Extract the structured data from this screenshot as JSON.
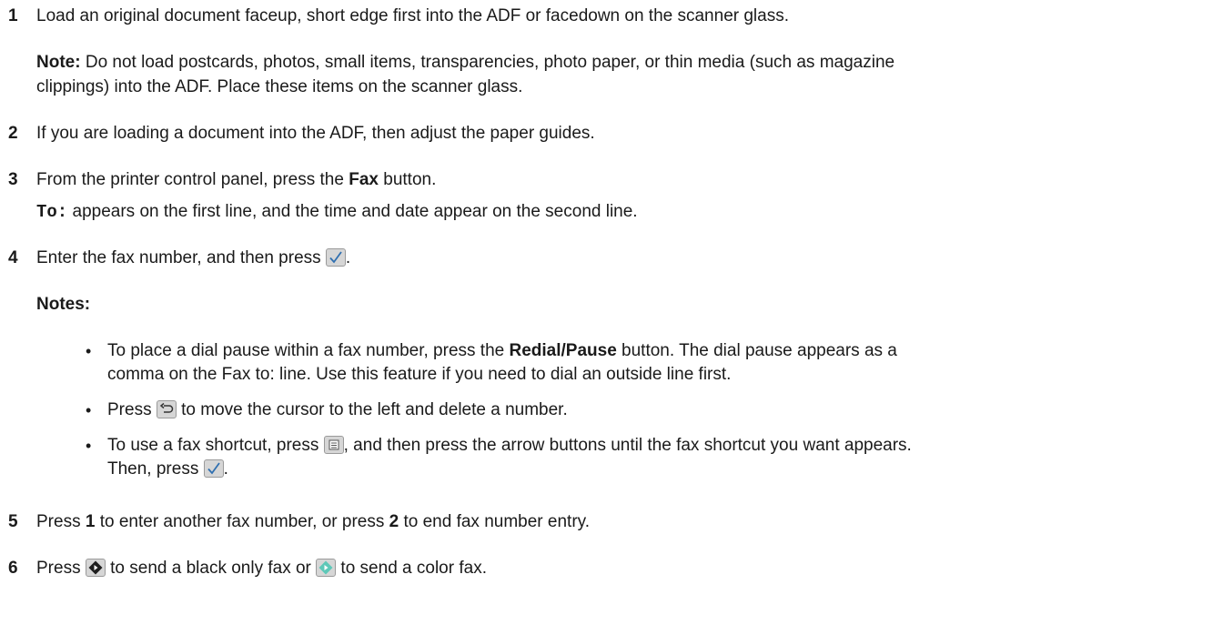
{
  "steps": [
    {
      "number": "1",
      "text": "Load an original document faceup, short edge first into the ADF or facedown on the scanner glass."
    },
    {
      "number": "2",
      "text": "If you are loading a document into the ADF, then adjust the paper guides."
    },
    {
      "number": "3",
      "text_before": "From the printer control panel, press the ",
      "bold": "Fax",
      "text_after": " button."
    },
    {
      "number": "4",
      "text_before": "Enter the fax number, and then press ",
      "text_after": "."
    },
    {
      "number": "5",
      "t1": "Press ",
      "b1": "1",
      "t2": " to enter another fax number, or press ",
      "b2": "2",
      "t3": " to end fax number entry."
    },
    {
      "number": "6",
      "t1": "Press ",
      "t2": " to send a black only fax or ",
      "t3": " to send a color fax."
    }
  ],
  "note": {
    "label": "Note:",
    "line1": " Do not load postcards, photos, small items, transparencies, photo paper, or thin media (such as magazine",
    "line2": "clippings) into the ADF. Place these items on the scanner glass."
  },
  "display_line": {
    "code": "To:",
    "text": " appears on the first line, and the time and date appear on the second line."
  },
  "notes_heading": "Notes:",
  "bullets": [
    {
      "t1": "To place a dial pause within a fax number, press the ",
      "b1": "Redial/Pause",
      "t2": " button. The dial pause appears as a",
      "line2": "comma on the Fax to: line. Use this feature if you need to dial an outside line first."
    },
    {
      "t1": "Press ",
      "t2": " to move the cursor to the left and delete a number."
    },
    {
      "t1": "To use a fax shortcut, press ",
      "t2": ", and then press the arrow buttons until the fax shortcut you want appears.",
      "line2a": "Then, press ",
      "line2b": "."
    }
  ],
  "bullet_char": "•",
  "icons": {
    "check": "check-button-icon",
    "back": "back-button-icon",
    "address_book": "address-book-button-icon",
    "start_black": "start-black-button-icon",
    "start_color": "start-color-button-icon"
  },
  "colors": {
    "text": "#1a1a1a",
    "icon_bg": "#d6d6d6",
    "check_mark": "#2f6fb0",
    "start_color": "#5ec8b8"
  }
}
